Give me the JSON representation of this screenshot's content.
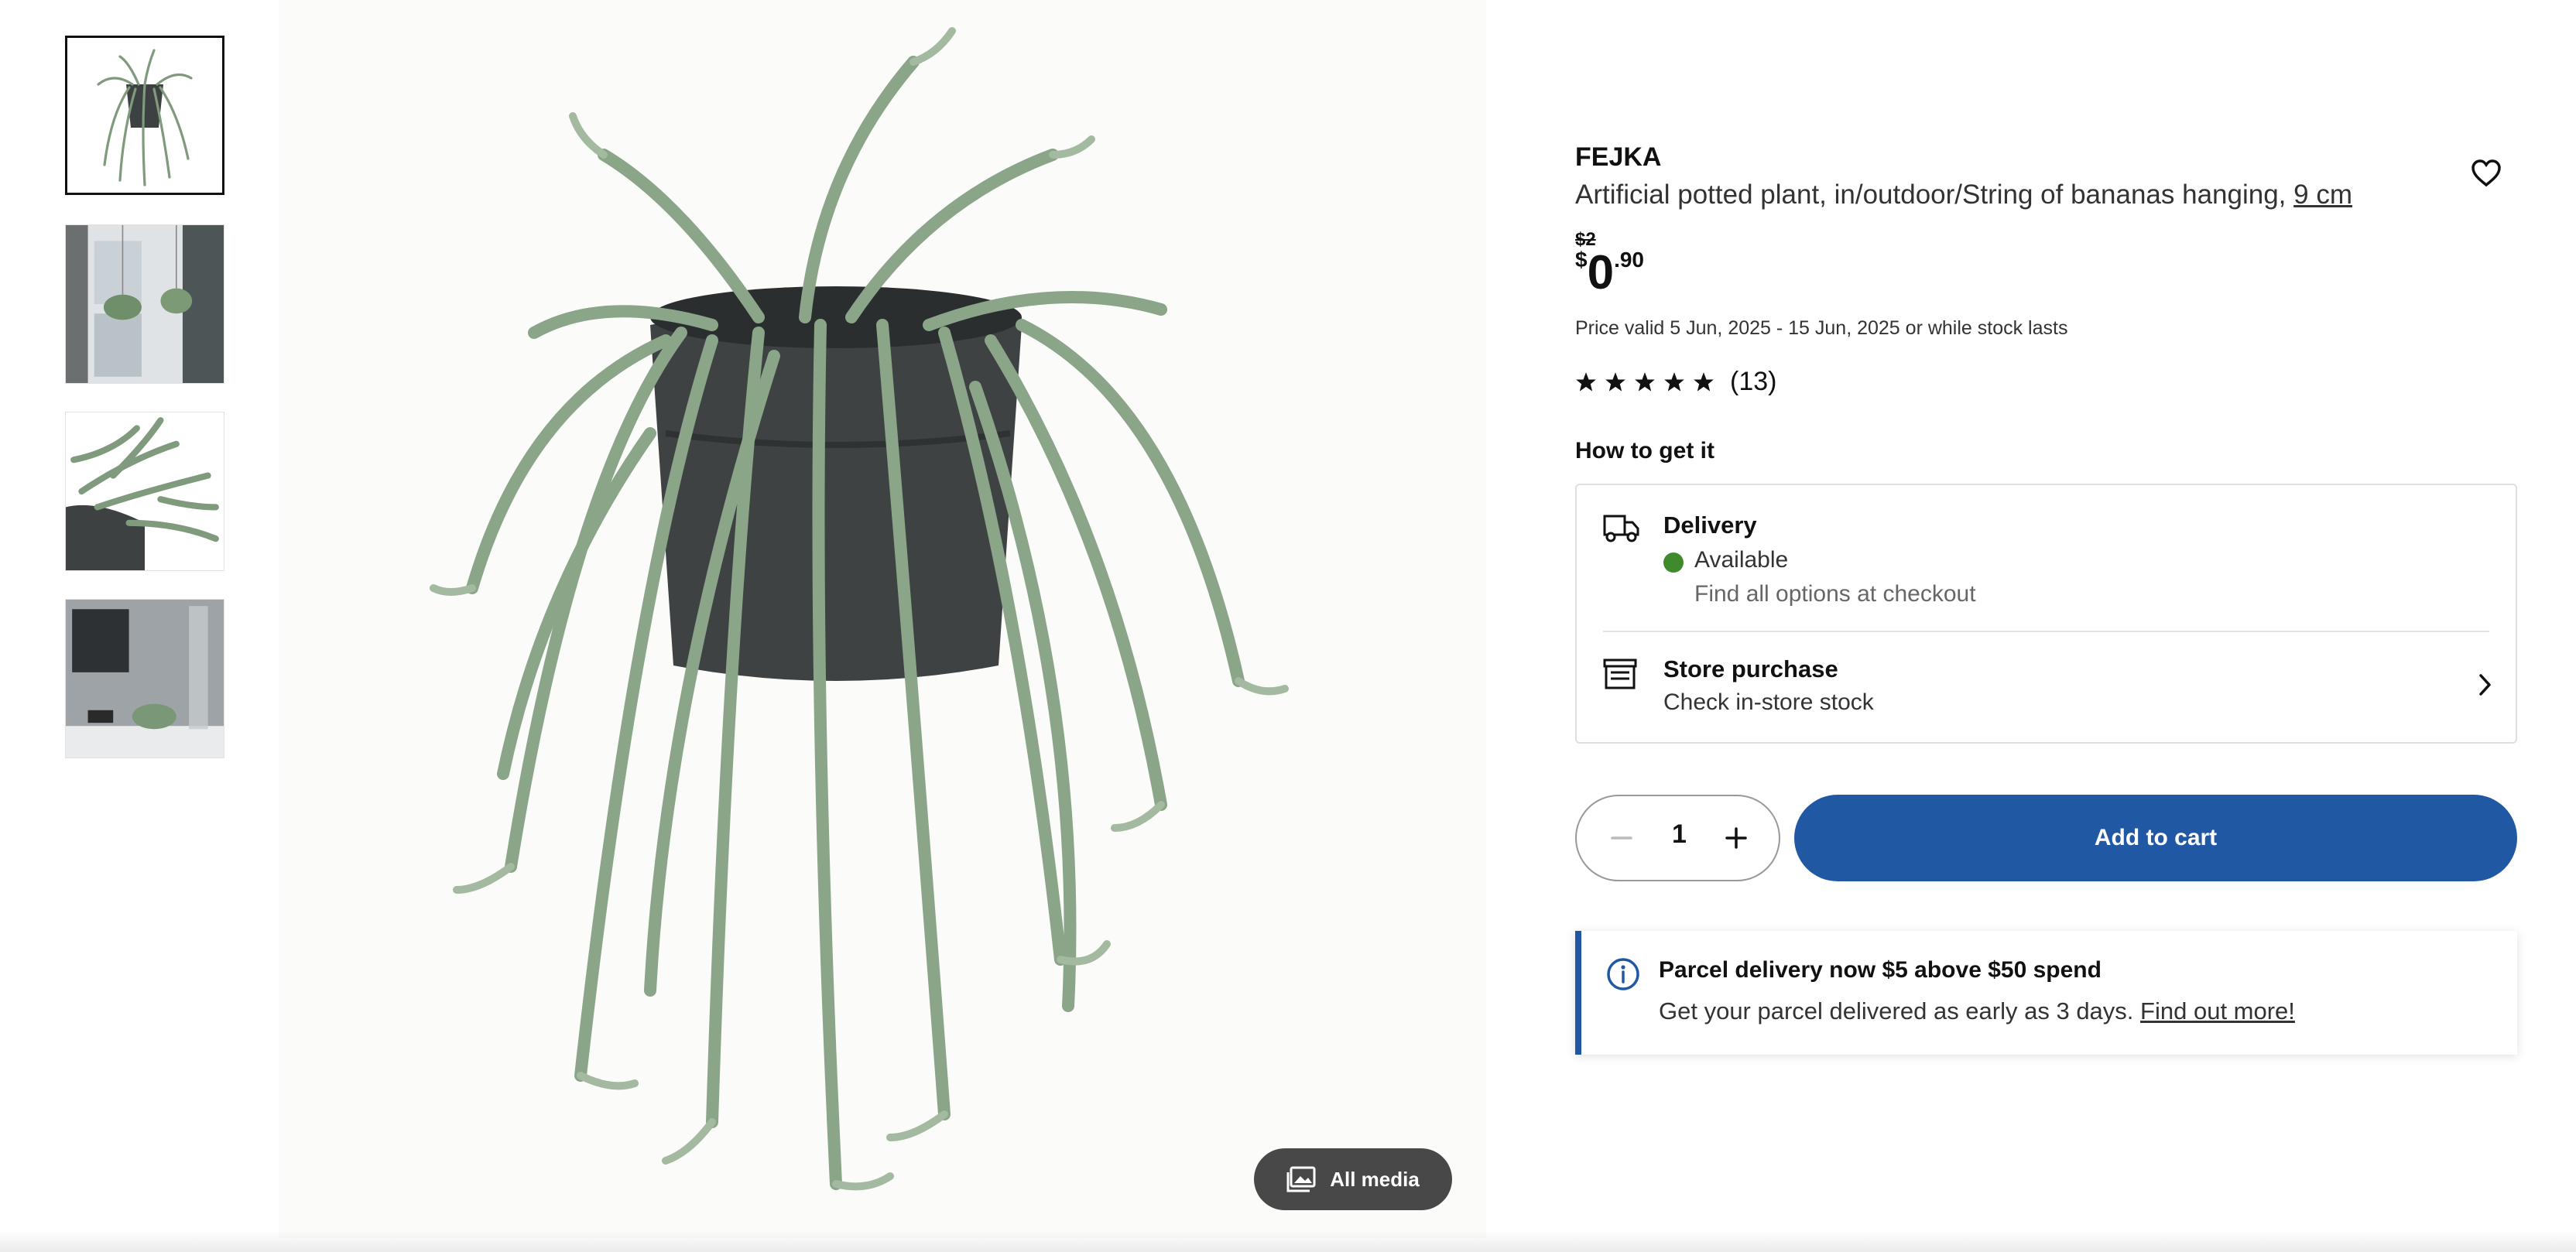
{
  "gallery": {
    "thumbnails": [
      {
        "name": "thumbnail-plant",
        "active": true
      },
      {
        "name": "thumbnail-window-hanging",
        "active": false
      },
      {
        "name": "thumbnail-closeup",
        "active": false
      },
      {
        "name": "thumbnail-shelf",
        "active": false
      }
    ],
    "all_media_label": "All media"
  },
  "product": {
    "brand": "FEJKA",
    "description": "Artificial potted plant, in/outdoor/String of bananas hanging,",
    "size_link": "9 cm",
    "old_price": "$2",
    "price_currency": "$",
    "price_integer": "0",
    "price_decimal": ".90",
    "price_validity": "Price valid 5 Jun, 2025 - 15 Jun, 2025 or while stock lasts",
    "rating_stars": 5,
    "review_count": "(13)",
    "wishlist_icon": "heart-icon"
  },
  "how_to_get": {
    "heading": "How to get it",
    "delivery": {
      "title": "Delivery",
      "status": "Available",
      "status_color": "#3f8a2c",
      "note": "Find all options at checkout",
      "icon": "truck-icon"
    },
    "store": {
      "title": "Store purchase",
      "note": "Check in-store stock",
      "icon": "store-icon"
    }
  },
  "cart": {
    "quantity": "1",
    "add_label": "Add to cart",
    "accent": "#2158a4"
  },
  "notice": {
    "title": "Parcel delivery now $5 above $50 spend",
    "text": "Get your parcel delivered as early as 3 days.",
    "link": "Find out more!",
    "icon": "info-icon"
  }
}
